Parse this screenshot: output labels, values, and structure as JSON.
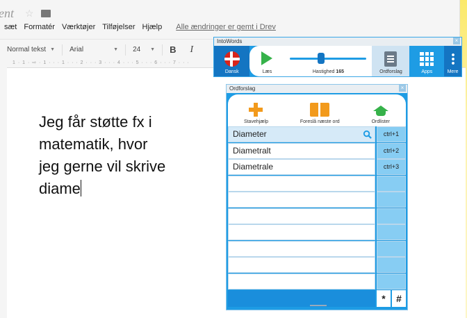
{
  "doc": {
    "title": "ent",
    "star": "☆"
  },
  "menu": {
    "items": [
      "sæt",
      "Formatér",
      "Værktøjer",
      "Tilføjelser",
      "Hjælp"
    ],
    "saved_status": "Alle ændringer er gemt i Drev"
  },
  "toolbar": {
    "style": "Normal tekst",
    "font": "Arial",
    "size": "24",
    "bold": "B",
    "italic": "I"
  },
  "ruler": "1 · 1 · ⇨ · 1 · · · 1 · · · 2 · · · 3 · · · 4 · · · 5 · · · 6 · · · 7 · · ·",
  "body_text": {
    "line1": "Jeg får støtte fx i",
    "line2": "matematik, hvor",
    "line3": "jeg gerne vil skrive",
    "line4": "diame"
  },
  "intowords": {
    "title": "IntoWords",
    "close": "×",
    "language_label": "Dansk",
    "read_label": "Læs",
    "speed_label": "Hastighed",
    "speed_value": "165",
    "speed_level": 0.4,
    "wordsuggest_label": "Ordforslag",
    "apps_label": "Apps",
    "more_label": "Mere"
  },
  "ordforslag": {
    "title": "Ordforslag",
    "close": "×",
    "tools": {
      "spelling": "Stavehjælp",
      "next_word": "Foreslå næste ord",
      "wordlists": "Ordlister"
    },
    "suggestions": [
      {
        "word": "Diameter",
        "shortcut": "ctrl+1"
      },
      {
        "word": "Diametralt",
        "shortcut": "ctrl+2"
      },
      {
        "word": "Diametrale",
        "shortcut": "ctrl+3"
      }
    ],
    "empty_rows": 7,
    "foot_star": "*",
    "foot_hash": "#"
  },
  "colors": {
    "accent_blue": "#1e9ce4",
    "dark_blue": "#1475c2",
    "shortcut_blue": "#87cdf3",
    "orange": "#f29a1c",
    "green": "#36b24a",
    "flag_red": "#d9241b"
  }
}
